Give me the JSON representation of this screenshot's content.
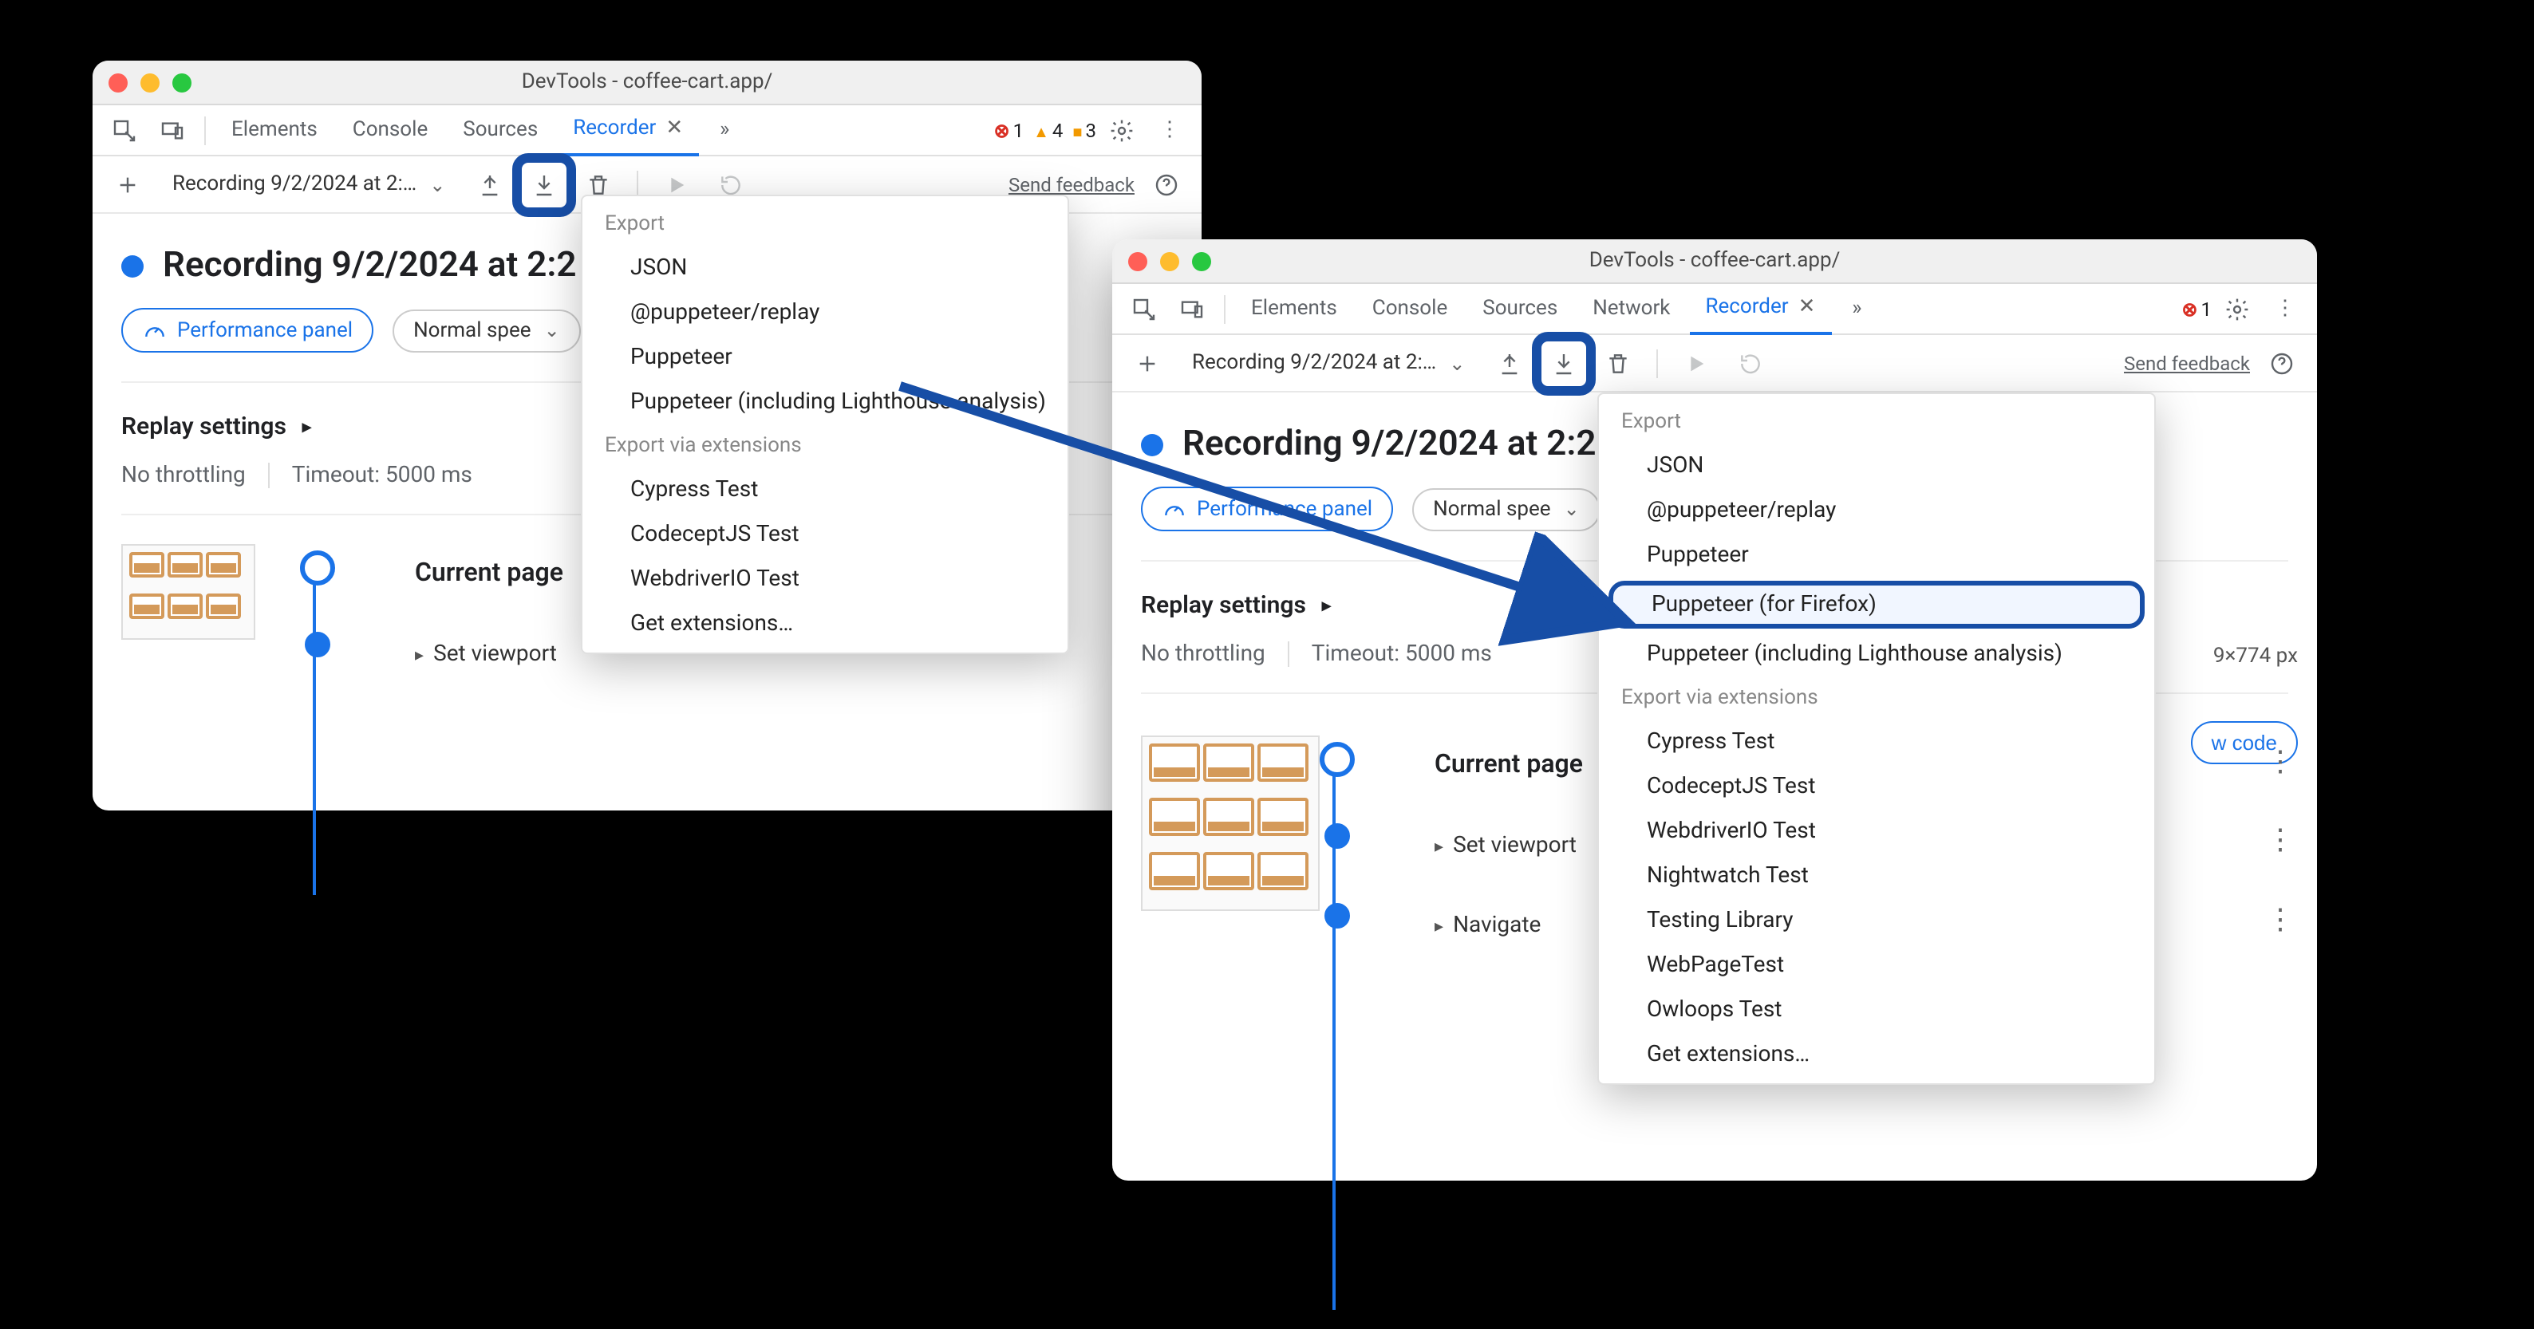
{
  "window1": {
    "title": "DevTools - coffee-cart.app/",
    "tabs": [
      "Elements",
      "Console",
      "Sources",
      "Recorder"
    ],
    "active_tab": "Recorder",
    "counts": {
      "errors": "1",
      "warnings": "4",
      "issues": "3"
    },
    "recording_select": "Recording 9/2/2024 at 2:…",
    "feedback": "Send feedback",
    "recording_title": "Recording 9/2/2024 at 2:2",
    "perf_label": "Performance panel",
    "speed_label": "Normal spee",
    "replay_head": "Replay settings",
    "throttling": "No throttling",
    "timeout": "Timeout: 5000 ms",
    "step_current": "Current page",
    "step_viewport": "Set viewport",
    "menu": {
      "export_head": "Export",
      "items": [
        "JSON",
        "@puppeteer/replay",
        "Puppeteer",
        "Puppeteer (including Lighthouse analysis)"
      ],
      "ext_head": "Export via extensions",
      "ext_items": [
        "Cypress Test",
        "CodeceptJS Test",
        "WebdriverIO Test",
        "Get extensions…"
      ]
    }
  },
  "window2": {
    "title": "DevTools - coffee-cart.app/",
    "tabs": [
      "Elements",
      "Console",
      "Sources",
      "Network",
      "Recorder"
    ],
    "active_tab": "Recorder",
    "counts": {
      "errors": "1"
    },
    "recording_select": "Recording 9/2/2024 at 2:…",
    "feedback": "Send feedback",
    "recording_title": "Recording 9/2/2024 at 2:2",
    "perf_label": "Performance panel",
    "speed_label": "Normal spee",
    "replay_head": "Replay settings",
    "throttling": "No throttling",
    "timeout": "Timeout: 5000 ms",
    "dim_meta": "9×774 px",
    "show_code": "w code",
    "step_current": "Current page",
    "step_viewport": "Set viewport",
    "step_navigate": "Navigate",
    "menu": {
      "export_head": "Export",
      "items": [
        "JSON",
        "@puppeteer/replay",
        "Puppeteer",
        "Puppeteer (for Firefox)",
        "Puppeteer (including Lighthouse analysis)"
      ],
      "hl_index": 3,
      "ext_head": "Export via extensions",
      "ext_items": [
        "Cypress Test",
        "CodeceptJS Test",
        "WebdriverIO Test",
        "Nightwatch Test",
        "Testing Library",
        "WebPageTest",
        "Owloops Test",
        "Get extensions…"
      ]
    }
  }
}
